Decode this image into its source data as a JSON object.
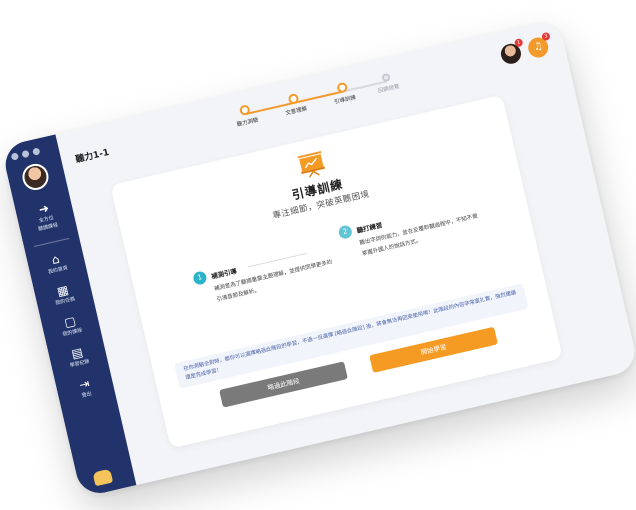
{
  "app": {
    "lesson_title": "聽力1-1"
  },
  "sidebar": {
    "items": [
      {
        "icon": "arrow-right-icon",
        "label_line1": "全方位",
        "label_line2": "聽讀課程"
      },
      {
        "icon": "home-icon",
        "label_line1": "我的首頁",
        "label_line2": ""
      },
      {
        "icon": "grid-icon",
        "label_line1": "我的任務",
        "label_line2": ""
      },
      {
        "icon": "book-icon",
        "label_line1": "我的課程",
        "label_line2": ""
      },
      {
        "icon": "document-icon",
        "label_line1": "學習紀錄",
        "label_line2": ""
      },
      {
        "icon": "logout-icon",
        "label_line1": "登出",
        "label_line2": ""
      }
    ]
  },
  "header": {
    "notification_count": "3",
    "avatar_count": "1"
  },
  "stepper": {
    "steps": [
      {
        "label": "聽力測驗",
        "state": "done"
      },
      {
        "label": "文意理解",
        "state": "done"
      },
      {
        "label": "引導訓練",
        "state": "current"
      },
      {
        "label": "回顧總覽",
        "state": "inactive"
      }
    ]
  },
  "main": {
    "title": "引導訓練",
    "subtitle": "專注細節，突破英聽困境",
    "points": [
      {
        "number": "1",
        "title": "補測引導",
        "text": "補測是為了聽擷重要主題理解，並提供同學更多的引導音節及解析。"
      },
      {
        "number": "2",
        "title": "聽打練習",
        "text": "聽出字詞的能力，並在反覆聆聽過程中，不知不覺掌握外國人的說話方式。"
      }
    ],
    "notice": "在你測驗全對時，都你可以選擇略過此階段的學習，不過一旦選擇 [略過此階段] 後，將會無法再回來使用唷！此階段的內容非常富扎實，強烈建議還是完成學習！",
    "skip_button": "略過此階段",
    "start_button": "開始學習"
  },
  "colors": {
    "accent": "#f59a23",
    "sidebar": "#21336a",
    "teal": "#2bb3c9"
  }
}
